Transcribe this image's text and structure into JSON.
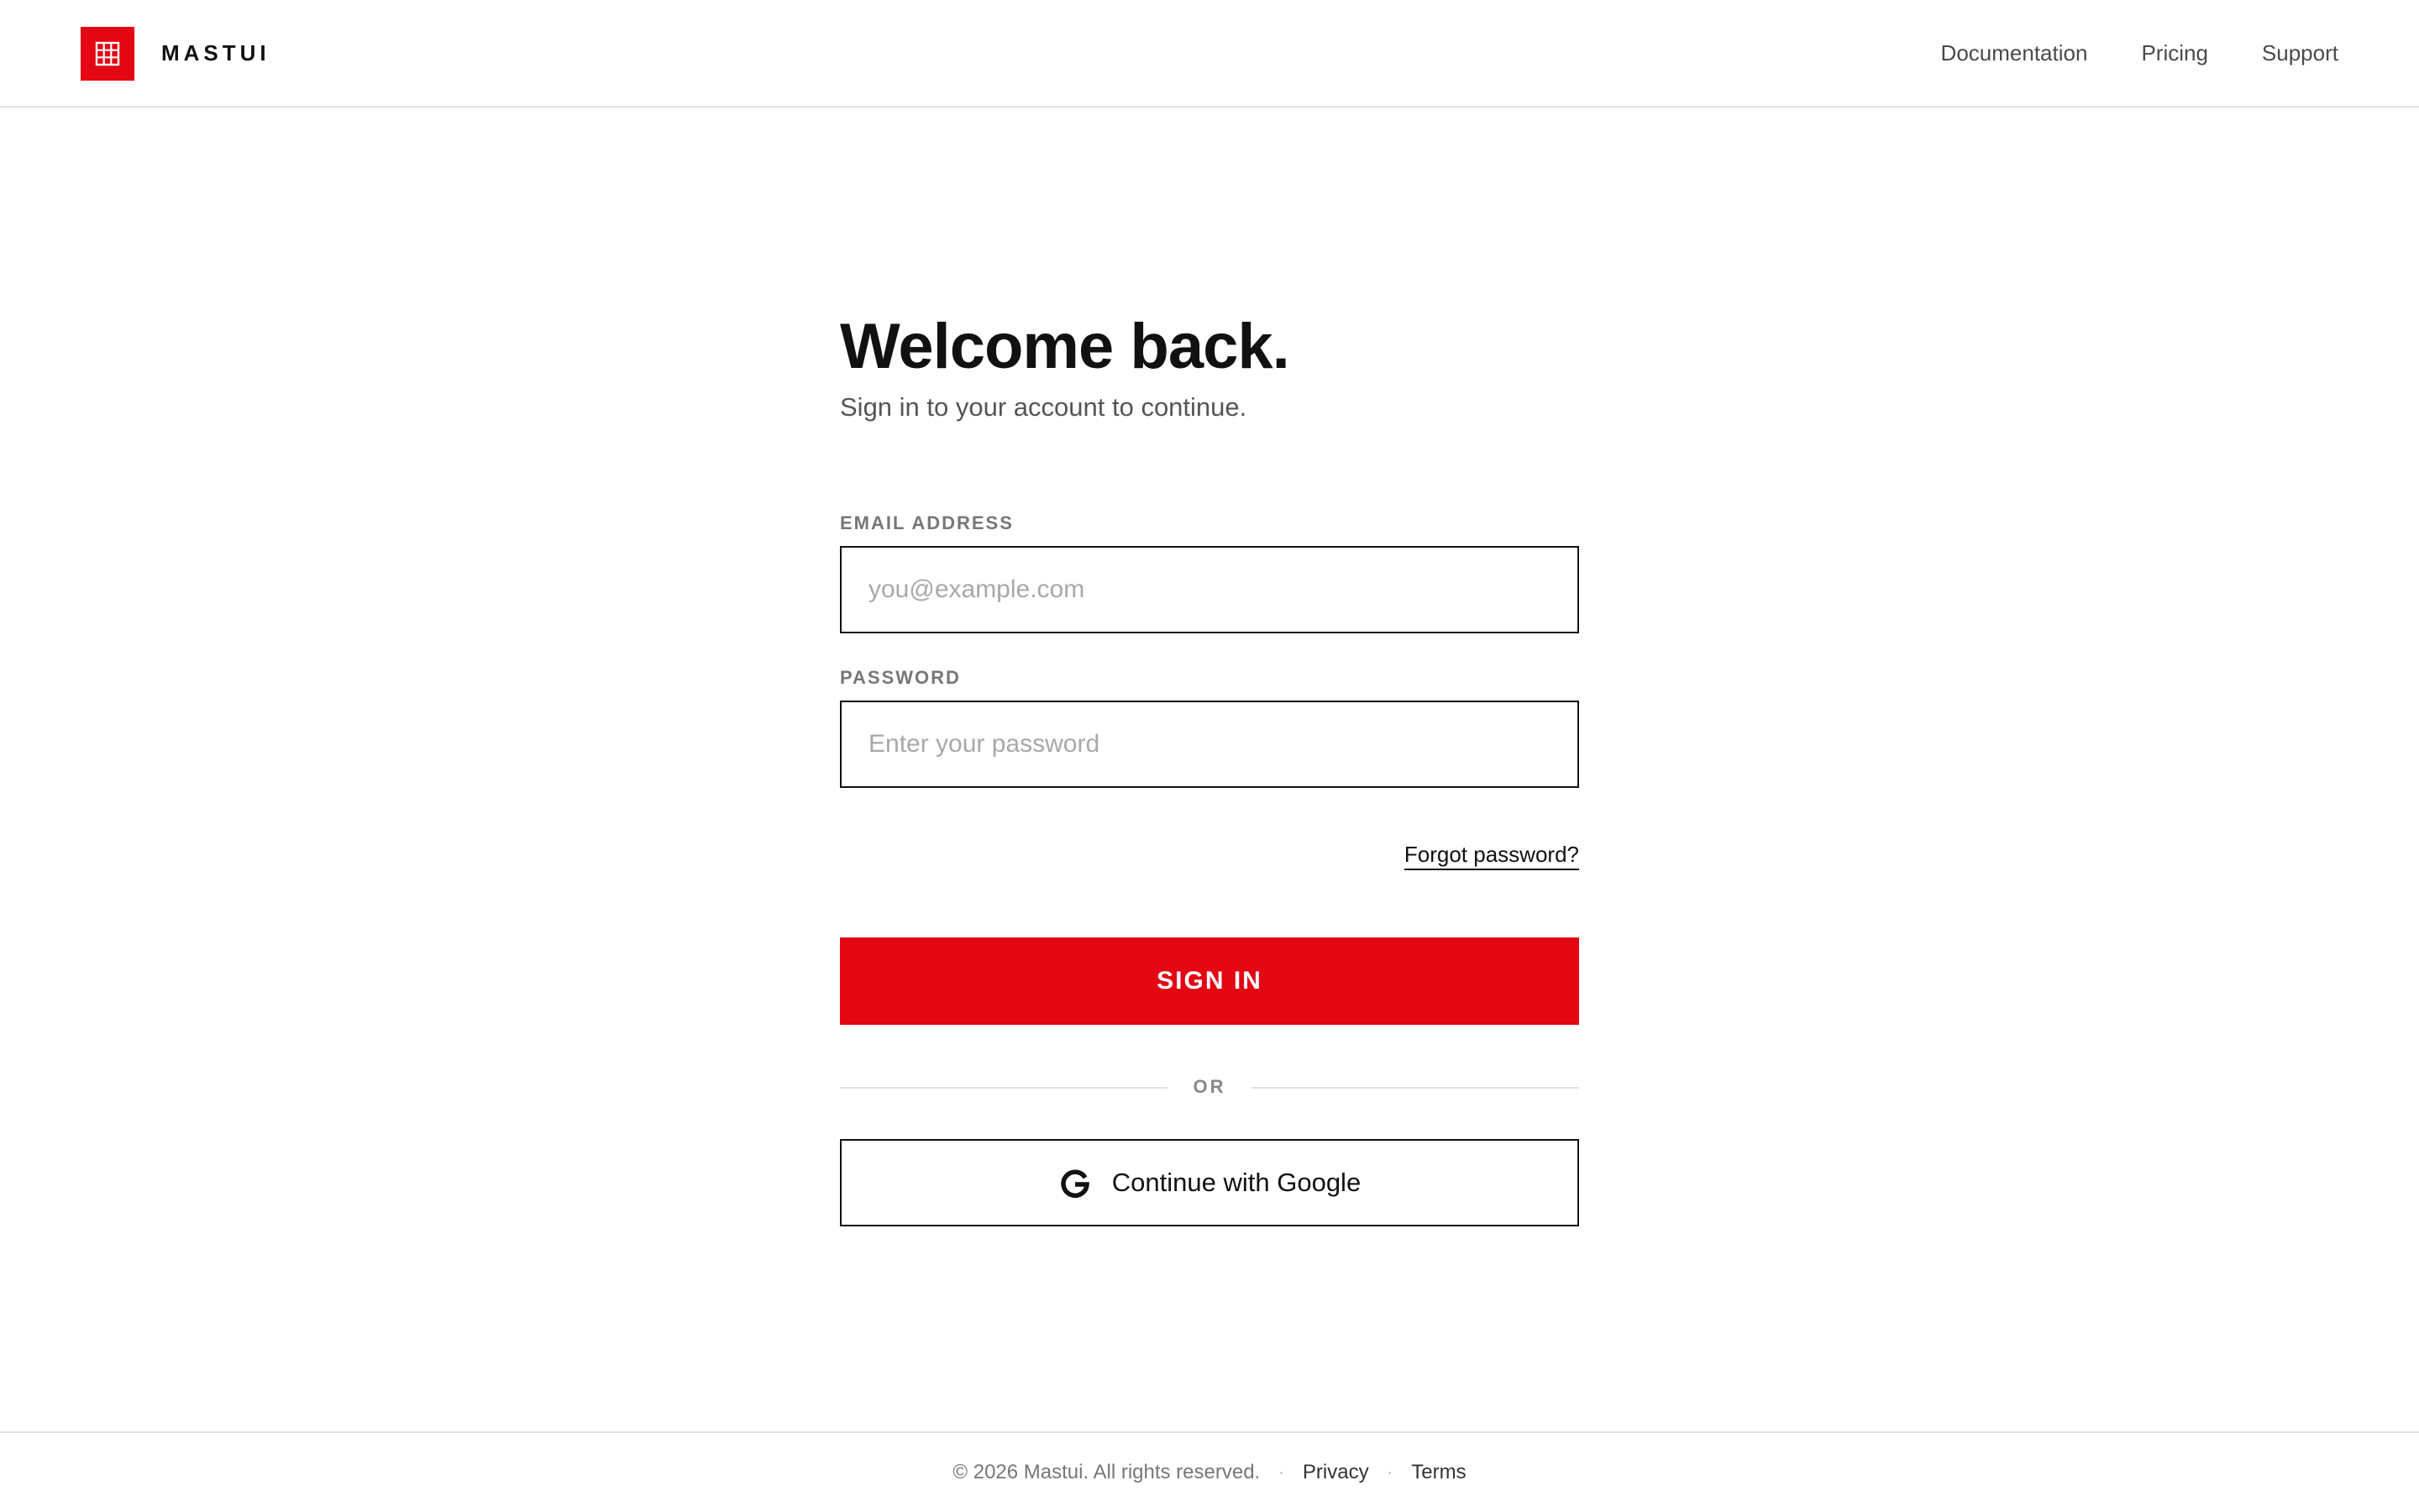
{
  "header": {
    "brand": "MASTUI",
    "logo_icon": "grid-building-icon",
    "nav": [
      {
        "label": "Documentation"
      },
      {
        "label": "Pricing"
      },
      {
        "label": "Support"
      }
    ]
  },
  "form": {
    "title": "Welcome back.",
    "subtitle": "Sign in to your account to continue.",
    "email": {
      "label": "EMAIL ADDRESS",
      "placeholder": "you@example.com",
      "value": ""
    },
    "password": {
      "label": "PASSWORD",
      "placeholder": "Enter your password",
      "value": ""
    },
    "forgot_label": "Forgot password?",
    "submit_label": "SIGN IN",
    "divider_label": "OR",
    "google": {
      "icon": "google-icon",
      "label": "Continue with Google"
    }
  },
  "footer": {
    "copyright": "© 2026 Mastui. All rights reserved.",
    "separator": "·",
    "links": [
      {
        "label": "Privacy"
      },
      {
        "label": "Terms"
      }
    ]
  },
  "colors": {
    "accent": "#e30613",
    "text": "#111111",
    "muted": "#777777",
    "border": "#e2e2e2"
  }
}
